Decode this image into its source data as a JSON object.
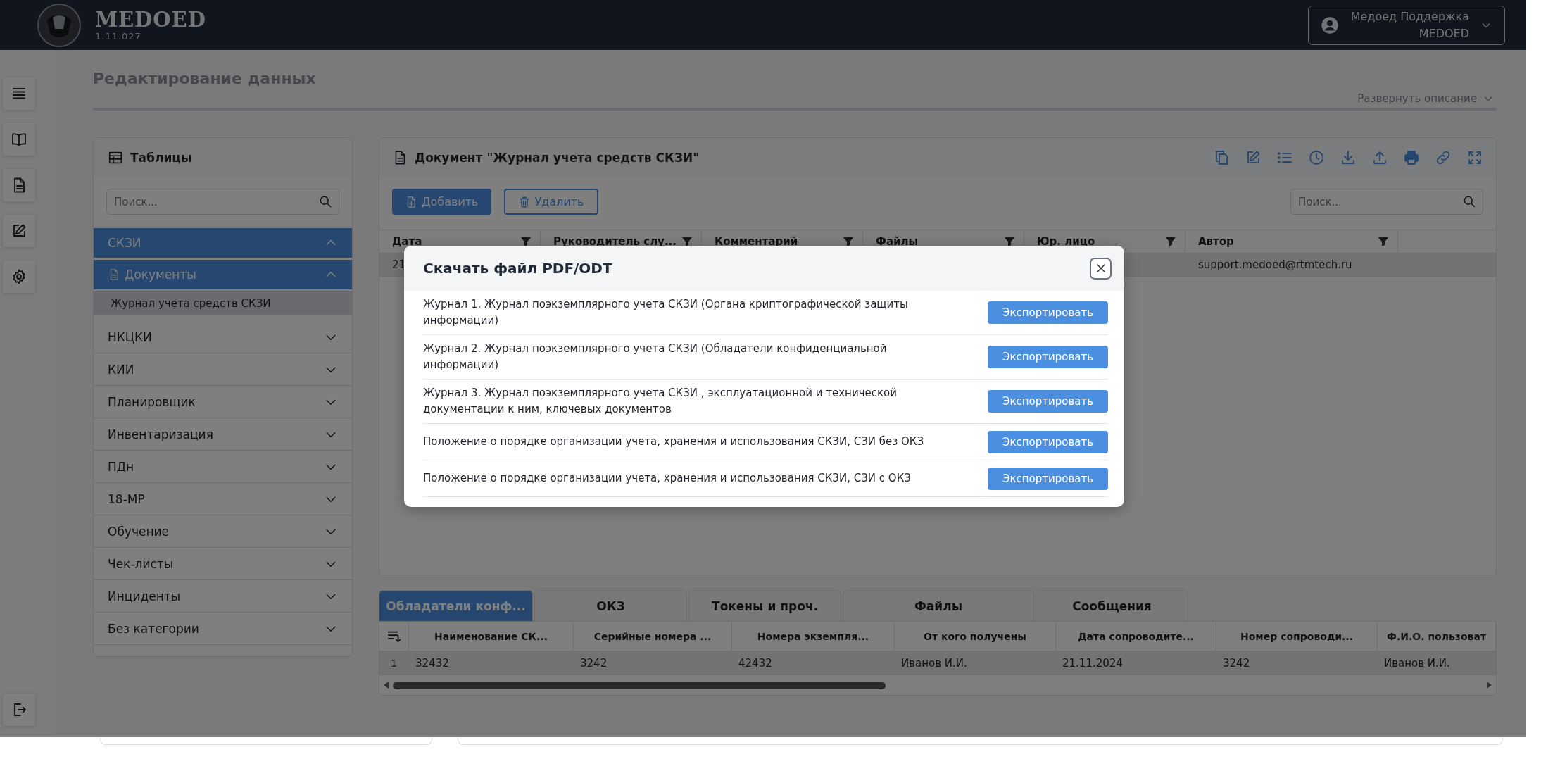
{
  "app": {
    "name": "MEDOED",
    "version": "1.11.027"
  },
  "user": {
    "name": "Медоед Поддержка",
    "org": "MEDOED"
  },
  "page": {
    "title": "Редактирование данных",
    "expand_link": "Развернуть описание"
  },
  "sidebar": {
    "title": "Таблицы",
    "search": {
      "placeholder": "Поиск..."
    },
    "items": [
      {
        "label": "СКЗИ",
        "expanded": true,
        "children": [
          {
            "label": "Документы",
            "expanded": true,
            "children": [
              {
                "label": "Журнал учета средств СКЗИ",
                "selected": true
              }
            ]
          }
        ]
      },
      {
        "label": "НКЦКИ",
        "expanded": false
      },
      {
        "label": "КИИ",
        "expanded": false
      },
      {
        "label": "Планировщик",
        "expanded": false
      },
      {
        "label": "Инвентаризация",
        "expanded": false
      },
      {
        "label": "ПДн",
        "expanded": false
      },
      {
        "label": "18-МР",
        "expanded": false
      },
      {
        "label": "Обучение",
        "expanded": false
      },
      {
        "label": "Чек-листы",
        "expanded": false
      },
      {
        "label": "Инциденты",
        "expanded": false
      },
      {
        "label": "Без категории",
        "expanded": false
      }
    ]
  },
  "document": {
    "title": "Документ \"Журнал учета средств СКЗИ\"",
    "buttons": [
      {
        "label": "Добавить",
        "kind": "primary"
      },
      {
        "label": "Удалить",
        "kind": "outline"
      }
    ],
    "search": {
      "placeholder": "Поиск..."
    },
    "table": {
      "columns": [
        "Дата",
        "Руководитель слу...",
        "Комментарий",
        "Файлы",
        "Юр. лицо",
        "Автор"
      ],
      "rows": [
        {
          "selected": true,
          "date": "21",
          "author": "support.medoed@rtmtech.ru"
        }
      ]
    }
  },
  "tabs": [
    {
      "label": "Обладатели конф...",
      "selected": true
    },
    {
      "label": "ОКЗ",
      "selected": false
    },
    {
      "label": "Токены и проч.",
      "selected": false
    },
    {
      "label": "Файлы",
      "selected": false
    },
    {
      "label": "Сообщения",
      "selected": false
    }
  ],
  "detail_table": {
    "columns": [
      "Наименование СК...",
      "Серийные номера ...",
      "Номера экземпля...",
      "От кого получены",
      "Дата сопроводите...",
      "Номер сопроводи...",
      "Ф.И.О. пользоват"
    ],
    "rows": [
      {
        "number": "1",
        "selected": true,
        "cells": [
          "32432",
          "3242",
          "42432",
          "Иванов И.И.",
          "21.11.2024",
          "3242",
          "Иванов И.И."
        ]
      }
    ]
  },
  "modal": {
    "title": "Скачать файл PDF/ODT",
    "items": [
      {
        "text": "Журнал 1. Журнал поэкземплярного учета СКЗИ (Органа криптографической защиты информации)",
        "button": "Экспортировать"
      },
      {
        "text": "Журнал 2. Журнал поэкземплярного учета СКЗИ (Обладатели конфиденциальной информации)",
        "button": "Экспортировать"
      },
      {
        "text": "Журнал 3. Журнал поэкземплярного учета СКЗИ , эксплуатационной и технической документации к ним, ключевых документов",
        "button": "Экспортировать"
      },
      {
        "text": "Положение о порядке организации учета, хранения и использования СКЗИ, СЗИ без ОКЗ",
        "button": "Экспортировать"
      },
      {
        "text": "Положение о порядке организации учета, хранения и использования СКЗИ, СЗИ с ОКЗ",
        "button": "Экспортировать"
      }
    ]
  }
}
